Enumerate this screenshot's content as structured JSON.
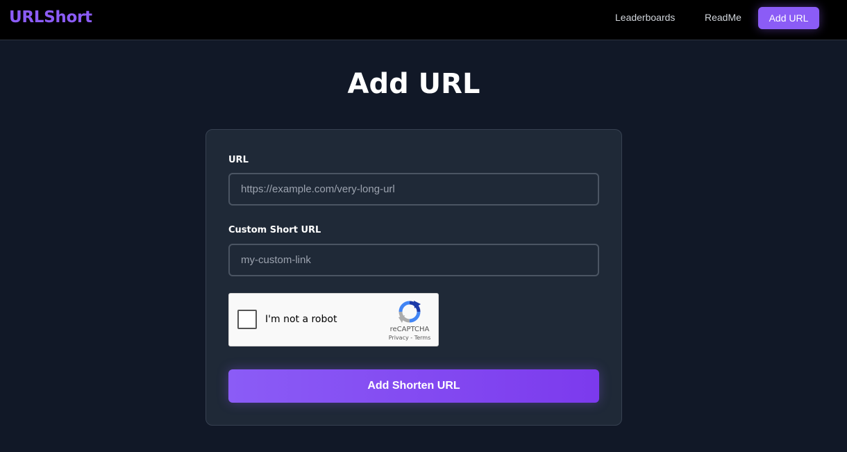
{
  "nav": {
    "brand": "URLShort",
    "links": [
      {
        "label": "Leaderboards"
      },
      {
        "label": "ReadMe"
      },
      {
        "label": "Add URL",
        "active": true
      }
    ]
  },
  "page": {
    "title": "Add URL"
  },
  "form": {
    "url_label": "URL",
    "url_placeholder": "https://example.com/very-long-url",
    "url_value": "",
    "custom_label": "Custom Short URL",
    "custom_placeholder": "my-custom-link",
    "custom_value": "",
    "recaptcha": {
      "label": "I'm not a robot",
      "checked": false,
      "brand": "reCAPTCHA",
      "privacy": "Privacy",
      "separator": " - ",
      "terms": "Terms",
      "icon": "recaptcha-logo-icon"
    },
    "submit_label": "Add Shorten URL"
  },
  "colors": {
    "background": "#111827",
    "navbar": "#000000",
    "accent": "#8b5cf6",
    "card": "#1f2937",
    "input_border": "#4b5563"
  }
}
